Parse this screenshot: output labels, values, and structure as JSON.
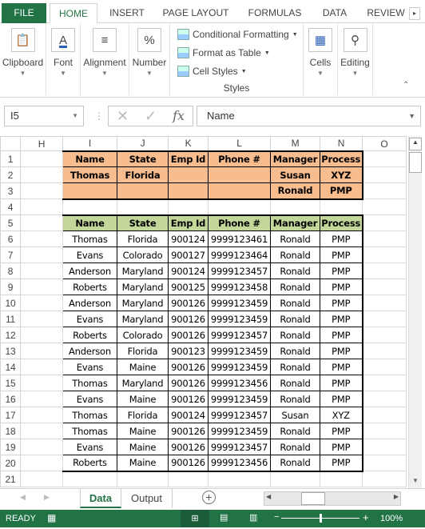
{
  "ribbon": {
    "tabs": [
      "FILE",
      "HOME",
      "INSERT",
      "PAGE LAYOUT",
      "FORMULAS",
      "DATA",
      "REVIEW"
    ],
    "groups": {
      "clipboard": "Clipboard",
      "font": "Font",
      "alignment": "Alignment",
      "number": "Number",
      "cells": "Cells",
      "editing": "Editing",
      "styles": "Styles"
    },
    "styles_items": [
      "Conditional Formatting",
      "Format as Table",
      "Cell Styles"
    ]
  },
  "formula_bar": {
    "name_box": "I5",
    "formula": "Name",
    "fx": "fx"
  },
  "columns": [
    "H",
    "I",
    "J",
    "K",
    "L",
    "M",
    "N",
    "O"
  ],
  "rows": [
    "1",
    "2",
    "3",
    "4",
    "5",
    "6",
    "7",
    "8",
    "9",
    "10",
    "11",
    "12",
    "13",
    "14",
    "15",
    "16",
    "17",
    "18",
    "19",
    "20",
    "21"
  ],
  "criteria_table": {
    "headers": [
      "Name",
      "State",
      "Emp Id",
      "Phone #",
      "Manager",
      "Process"
    ],
    "rows": [
      [
        "Thomas",
        "Florida",
        "",
        "",
        "Susan",
        "XYZ"
      ],
      [
        "",
        "",
        "",
        "",
        "Ronald",
        "PMP"
      ]
    ],
    "color": "#f8bd8e"
  },
  "data_table": {
    "headers": [
      "Name",
      "State",
      "Emp Id",
      "Phone #",
      "Manager",
      "Process"
    ],
    "header_color": "#c4d79b",
    "rows": [
      [
        "Thomas",
        "Florida",
        "900124",
        "9999123461",
        "Ronald",
        "PMP"
      ],
      [
        "Evans",
        "Colorado",
        "900127",
        "9999123464",
        "Ronald",
        "PMP"
      ],
      [
        "Anderson",
        "Maryland",
        "900124",
        "9999123457",
        "Ronald",
        "PMP"
      ],
      [
        "Roberts",
        "Maryland",
        "900125",
        "9999123458",
        "Ronald",
        "PMP"
      ],
      [
        "Anderson",
        "Maryland",
        "900126",
        "9999123459",
        "Ronald",
        "PMP"
      ],
      [
        "Evans",
        "Maryland",
        "900126",
        "9999123459",
        "Ronald",
        "PMP"
      ],
      [
        "Roberts",
        "Colorado",
        "900126",
        "9999123457",
        "Ronald",
        "PMP"
      ],
      [
        "Anderson",
        "Florida",
        "900123",
        "9999123459",
        "Ronald",
        "PMP"
      ],
      [
        "Evans",
        "Maine",
        "900126",
        "9999123459",
        "Ronald",
        "PMP"
      ],
      [
        "Thomas",
        "Maryland",
        "900126",
        "9999123456",
        "Ronald",
        "PMP"
      ],
      [
        "Evans",
        "Maine",
        "900126",
        "9999123459",
        "Ronald",
        "PMP"
      ],
      [
        "Thomas",
        "Florida",
        "900124",
        "9999123457",
        "Susan",
        "XYZ"
      ],
      [
        "Thomas",
        "Maine",
        "900126",
        "9999123459",
        "Ronald",
        "PMP"
      ],
      [
        "Evans",
        "Maine",
        "900126",
        "9999123457",
        "Ronald",
        "PMP"
      ],
      [
        "Roberts",
        "Maine",
        "900126",
        "9999123456",
        "Ronald",
        "PMP"
      ]
    ]
  },
  "sheets": {
    "tabs": [
      "Data",
      "Output"
    ],
    "active": "Data"
  },
  "status": {
    "text": "READY",
    "zoom": "100%"
  },
  "colors": {
    "accent": "#217346"
  }
}
